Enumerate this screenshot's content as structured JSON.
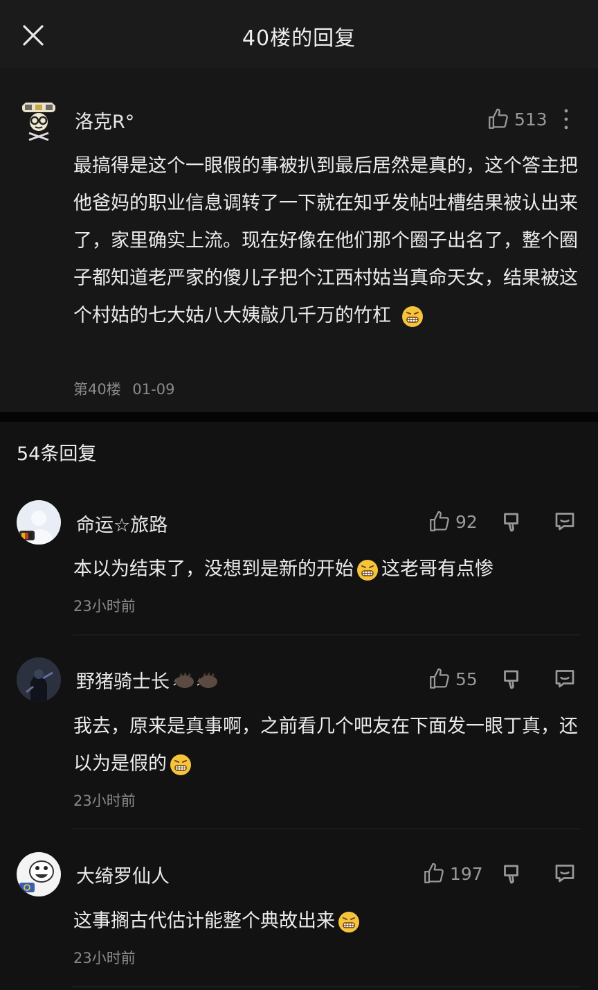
{
  "header": {
    "title": "40楼的回复"
  },
  "main_post": {
    "username": "洛克R°",
    "likes": "513",
    "text": "最搞得是这个一眼假的事被扒到最后居然是真的，这个答主把他爸妈的职业信息调转了一下就在知乎发帖吐槽结果被认出来了，家里确实上流。现在好像在他们那个圈子出名了，整个圈子都知道老严家的傻儿子把个江西村姑当真命天女，结果被这个村姑的七大姑八大姨敲几千万的竹杠",
    "floor": "第40楼",
    "date": "01-09"
  },
  "replies_header": {
    "count_label": "54条回复"
  },
  "replies": [
    {
      "username": "命运☆旅路",
      "likes": "92",
      "text_before": "本以为结束了，没想到是新的开始",
      "text_after": "这老哥有点惨",
      "time": "23小时前"
    },
    {
      "username": "野猪骑士长",
      "likes": "55",
      "text": "我去，原来是真事啊，之前看几个吧友在下面发一眼丁真，还以为是假的",
      "time": "23小时前"
    },
    {
      "username": "大绮罗仙人",
      "likes": "197",
      "text": "这事搁古代估计能整个典故出来",
      "time": "23小时前"
    }
  ],
  "icons": {
    "close": "close-icon",
    "like": "thumbs-up-icon",
    "more": "more-vertical-icon",
    "dislike": "thumbs-down-icon",
    "comment": "comment-icon",
    "emoji": "grimacing-emoji-icon"
  },
  "colors": {
    "background": "#121212",
    "text": "#ececec",
    "muted": "#8a8a8a"
  }
}
